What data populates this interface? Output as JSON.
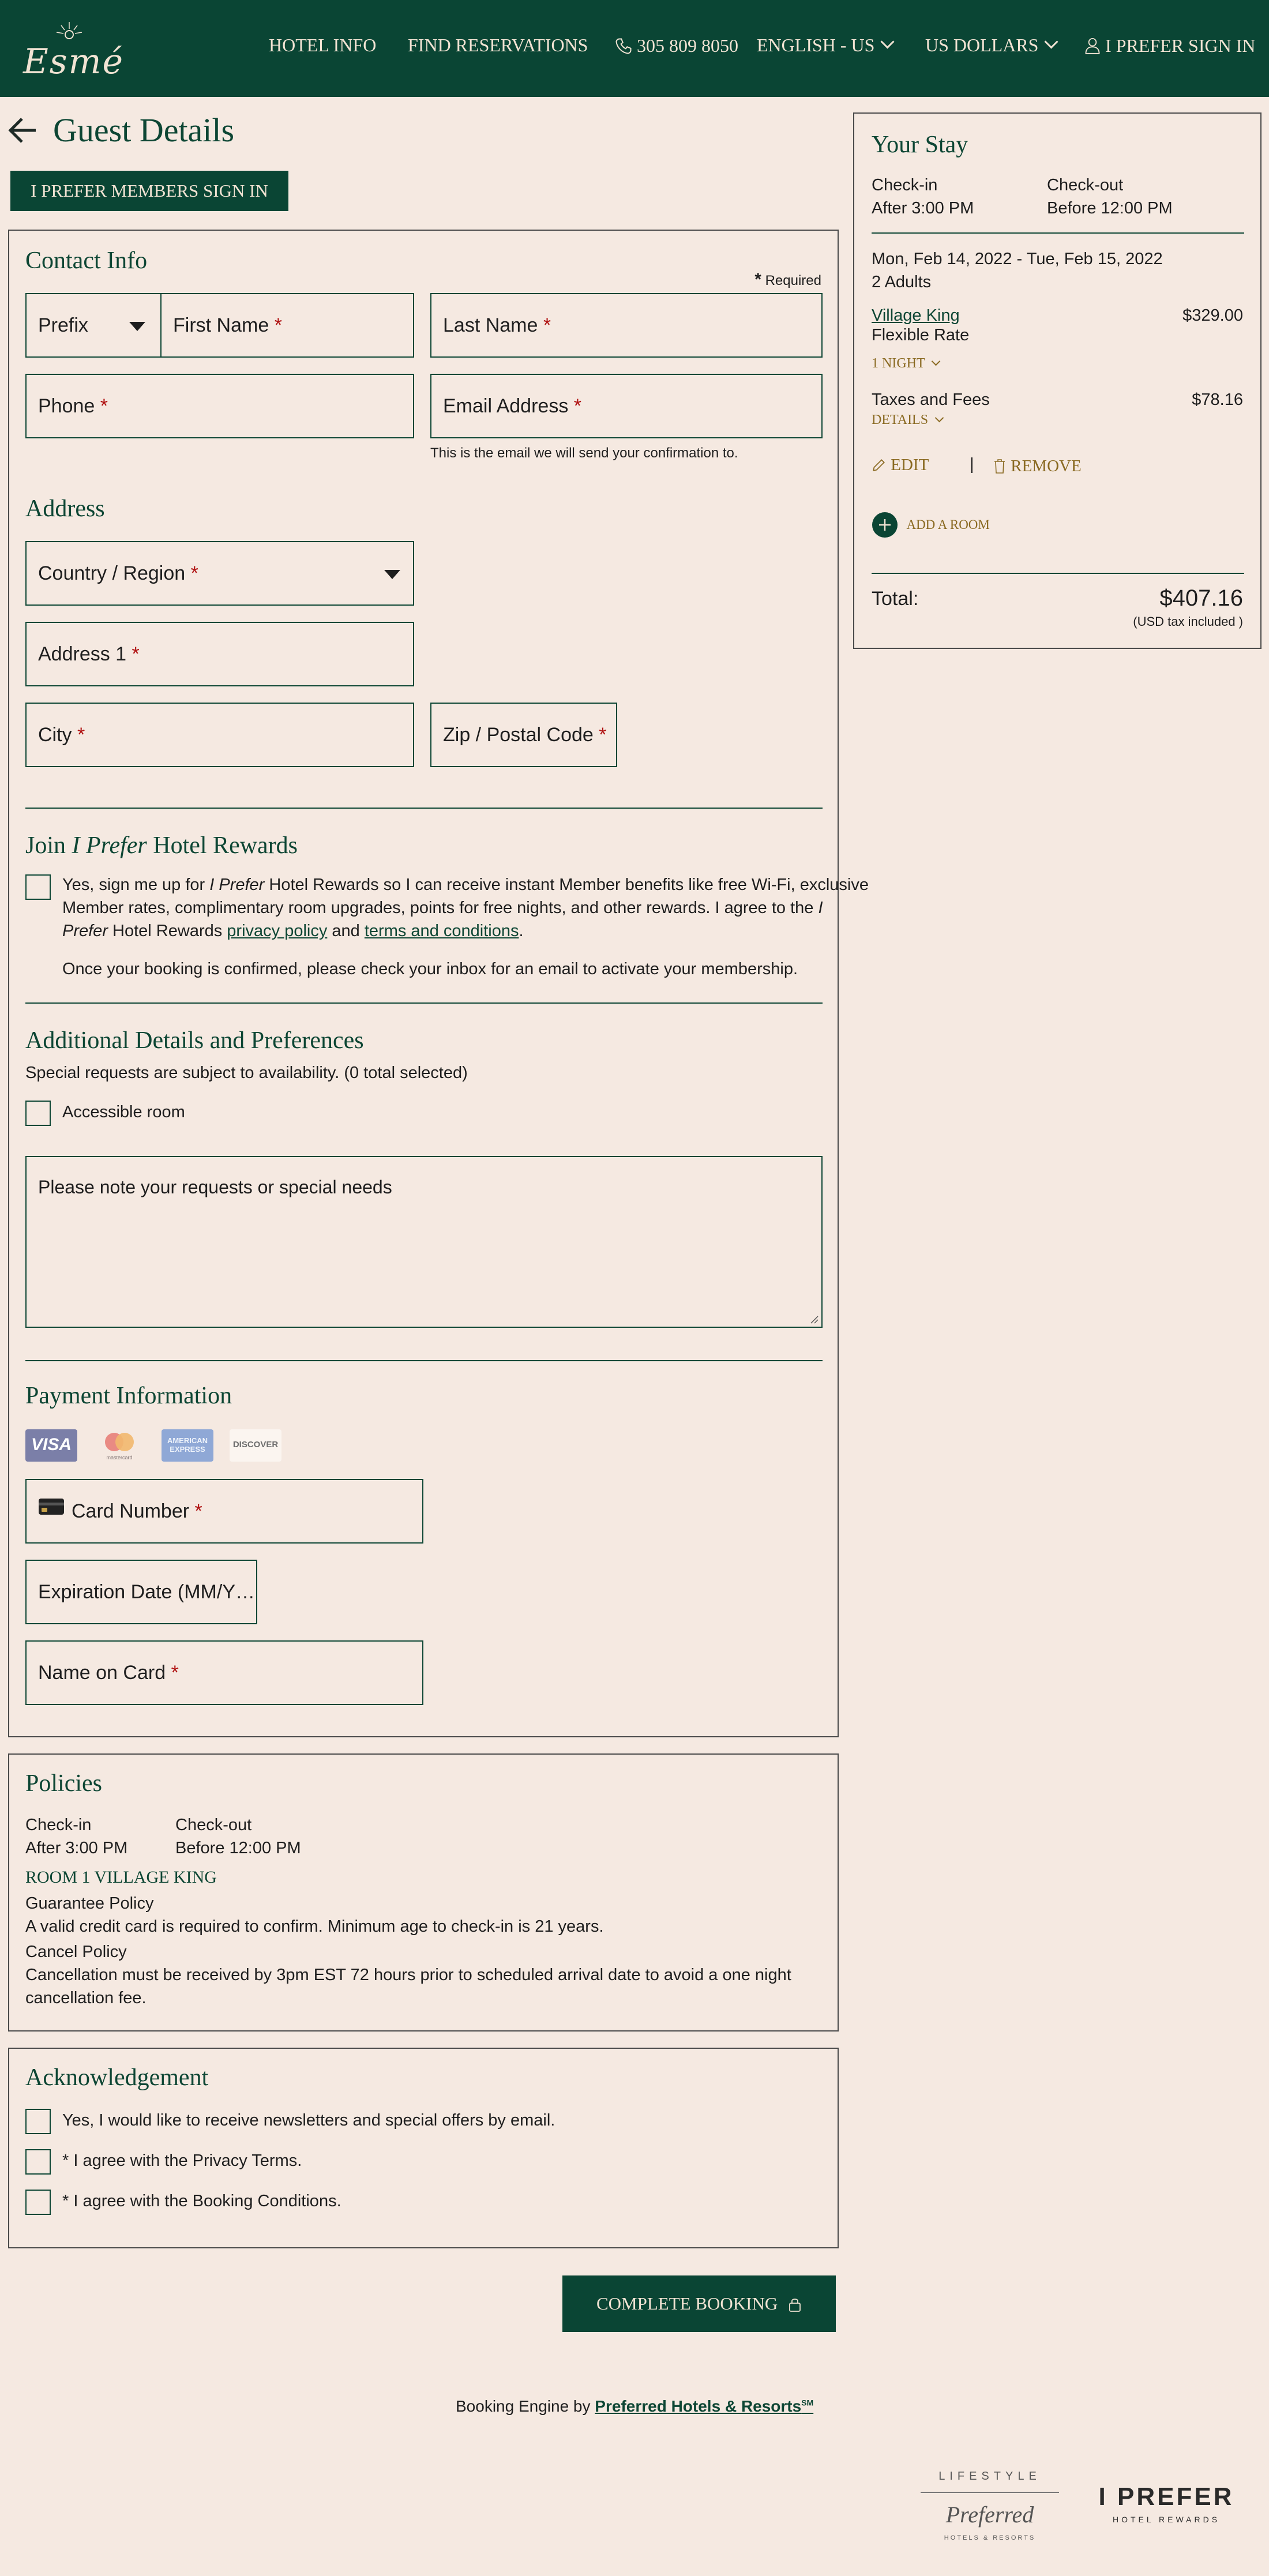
{
  "header": {
    "logo_text": "Esmé",
    "nav": [
      {
        "label": "HOTEL INFO"
      },
      {
        "label": "FIND RESERVATIONS"
      },
      {
        "label": "305 809 8050"
      },
      {
        "label": "ENGLISH - US"
      },
      {
        "label": "US DOLLARS"
      },
      {
        "label": "I PREFER SIGN IN"
      }
    ]
  },
  "page": {
    "title": "Guest Details",
    "members_button": "I PREFER MEMBERS SIGN IN"
  },
  "contact": {
    "title": "Contact Info",
    "required_note": "Required",
    "prefix": "Prefix",
    "first_name": "First Name",
    "last_name": "Last Name",
    "phone": "Phone",
    "email": "Email Address",
    "email_hint": "This is the email we will send your confirmation to."
  },
  "address": {
    "title": "Address",
    "country": "Country / Region",
    "address1": "Address 1",
    "city": "City",
    "zip": "Zip / Postal Code"
  },
  "rewards": {
    "title_a": "Join",
    "title_b": "I Prefer",
    "title_c": "Hotel Rewards",
    "line1_a": "Yes, sign me up for",
    "line1_b": "I Prefer",
    "line1_c": "Hotel Rewards so I can receive instant Member benefits like free Wi-Fi, exclusive",
    "line2_a": "Member rates, complimentary room upgrades, points for free nights, and other rewards. I agree to the",
    "line2_b": "I",
    "line3_a": "Prefer",
    "line3_b": "Hotel Rewards",
    "privacy_link": "privacy policy",
    "and": "and",
    "terms_link": "terms and conditions",
    "period": ".",
    "note": "Once your booking is confirmed, please check your inbox for an email to activate your membership."
  },
  "additional": {
    "title": "Additional Details and Preferences",
    "subtitle": "Special requests are subject to availability. (0 total selected)",
    "accessible": "Accessible room",
    "requests_placeholder": "Please note your requests or special needs"
  },
  "payment": {
    "title": "Payment Information",
    "cards": [
      "VISA",
      "mastercard",
      "AMERICAN EXPRESS",
      "DISCOVER"
    ],
    "card_number": "Card Number",
    "expiration": "Expiration Date (MM/Y…",
    "name_on_card": "Name on Card"
  },
  "policies": {
    "title": "Policies",
    "checkin_label": "Check-in",
    "checkin_value": "After 3:00 PM",
    "checkout_label": "Check-out",
    "checkout_value": "Before 12:00 PM",
    "room_heading": "ROOM 1 VILLAGE KING",
    "guarantee_label": "Guarantee Policy",
    "guarantee_text": "A valid credit card is required to confirm. Minimum age to check-in is 21 years.",
    "cancel_label": "Cancel Policy",
    "cancel_text_1": "Cancellation must be received by 3pm EST 72 hours prior to scheduled arrival date to avoid a one night",
    "cancel_text_2": "cancellation fee."
  },
  "ack": {
    "title": "Acknowledgement",
    "items": [
      "Yes, I would like to receive newsletters and special offers by email.",
      "* I agree with the Privacy Terms.",
      "* I agree with the Booking Conditions."
    ]
  },
  "complete_button": "COMPLETE BOOKING",
  "footer": {
    "engine_prefix": "Booking Engine by",
    "engine_link": "Preferred Hotels & Resorts",
    "sm": "SM",
    "logo1_top": "LIFESTYLE",
    "logo1_mid": "Preferred",
    "logo1_bottom": "HOTELS & RESORTS",
    "logo2_top": "I PREFER",
    "logo2_bottom": "HOTEL REWARDS"
  },
  "stay": {
    "title": "Your Stay",
    "checkin_label": "Check-in",
    "checkin_value": "After 3:00 PM",
    "checkout_label": "Check-out",
    "checkout_value": "Before 12:00 PM",
    "dates": "Mon, Feb 14, 2022 - Tue, Feb 15, 2022",
    "guests": "2 Adults",
    "room": "Village King",
    "room_price": "$329.00",
    "rate": "Flexible Rate",
    "nights": "1 NIGHT",
    "taxes_label": "Taxes and Fees",
    "taxes_value": "$78.16",
    "details": "DETAILS",
    "edit": "EDIT",
    "sep": "|",
    "remove": "REMOVE",
    "add_room": "ADD A ROOM",
    "total_label": "Total:",
    "total_value": "$407.16",
    "tax_note": "(USD tax included )"
  }
}
